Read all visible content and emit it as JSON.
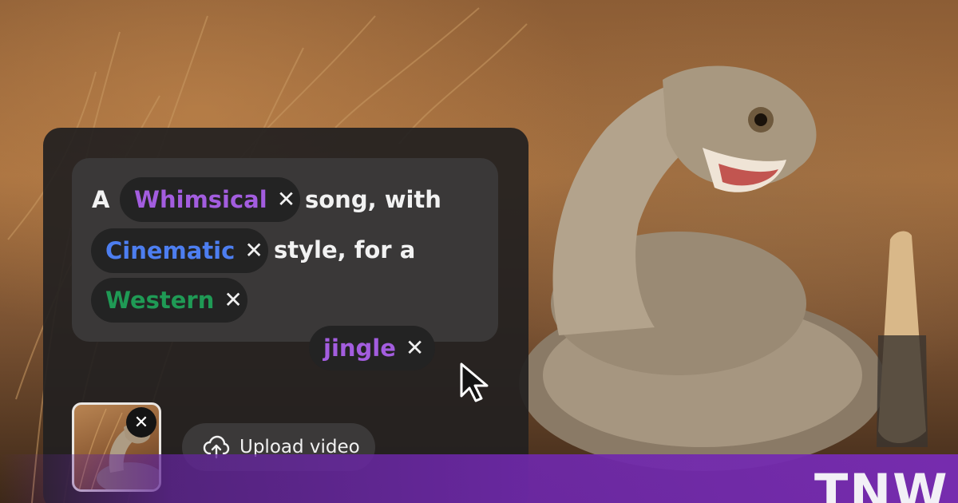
{
  "prompt": {
    "text_a": "A",
    "text_song_with": "song, with",
    "text_style_for_a": "style, for a",
    "chips": [
      {
        "label": "Whimsical",
        "color": "#a35ddf"
      },
      {
        "label": "Cinematic",
        "color": "#4d7ef0"
      },
      {
        "label": "Western",
        "color": "#1f9a55"
      },
      {
        "label": "jingle",
        "color": "#a35ddf"
      }
    ],
    "remove_glyph": "✕"
  },
  "upload": {
    "label": "Upload video",
    "icon": "cloud-upload-icon",
    "thumbnail_close_glyph": "✕"
  },
  "brand": {
    "logo_text": "TNW",
    "bar_color": "#6e28aa"
  }
}
